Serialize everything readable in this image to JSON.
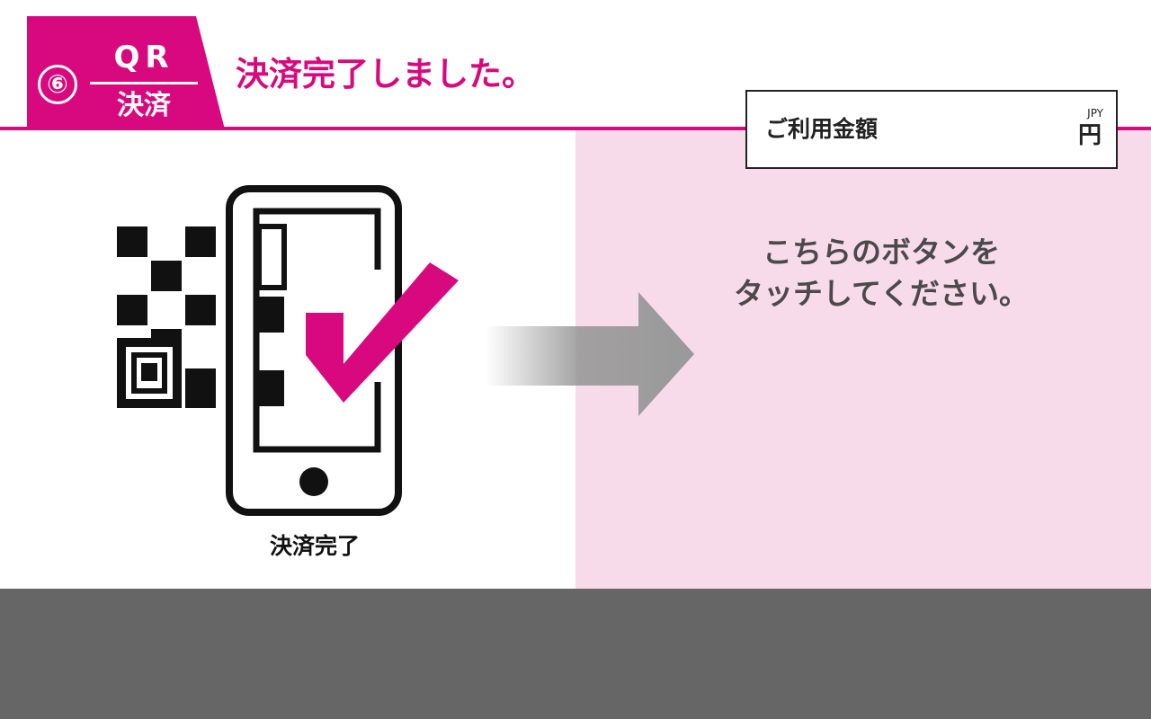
{
  "header": {
    "step_number": "⑥",
    "step_method_top": "QR",
    "step_method_bottom": "決済",
    "title": "決済完了しました。"
  },
  "amount_box": {
    "label": "ご利用金額",
    "currency_code": "JPY",
    "currency_unit": "円"
  },
  "instruction": {
    "line1": "こちらのボタンを",
    "line2": "タッチしてください。"
  },
  "illustration": {
    "caption": "決済完了",
    "icons": [
      "qr-code-icon",
      "smartphone-icon",
      "checkmark-icon",
      "arrow-right-icon"
    ]
  },
  "colors": {
    "accent": "#d8097e",
    "panel_pink": "#f8dbeb",
    "footer_gray": "#666666",
    "arrow_gray": "#999999"
  }
}
